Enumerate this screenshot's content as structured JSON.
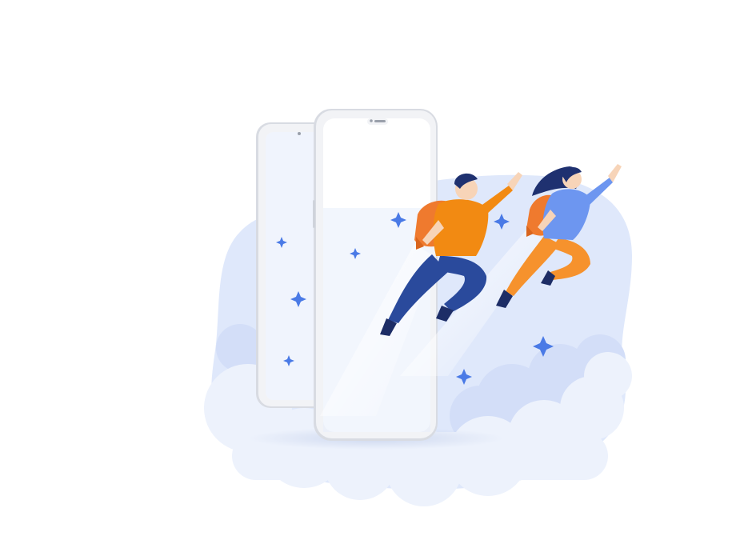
{
  "illustration": {
    "description_icons": [
      "phone-icon",
      "sparkle-icon",
      "cloud-icon",
      "jetpack-icon"
    ],
    "colors": {
      "background": "#ffffff",
      "blob": "#dfe8fb",
      "blob_light": "#e9f0fc",
      "cloud": "#edf2fc",
      "cloud_shadow": "#d3def8",
      "sparkle": "#4a7ae6",
      "phone_frame": "#f2f3f6",
      "phone_edge": "#d8dbe2",
      "phone_screen": "#ffffff",
      "shirt_orange": "#f28a12",
      "jetpack_orange": "#ef7a2e",
      "pants_navy": "#2a4a9c",
      "hair_navy": "#1f3170",
      "shirt_blue": "#6d96f0",
      "pants_orange": "#f6922d",
      "skin": "#f7d4b8",
      "shoe_dark": "#1d2d66"
    }
  }
}
